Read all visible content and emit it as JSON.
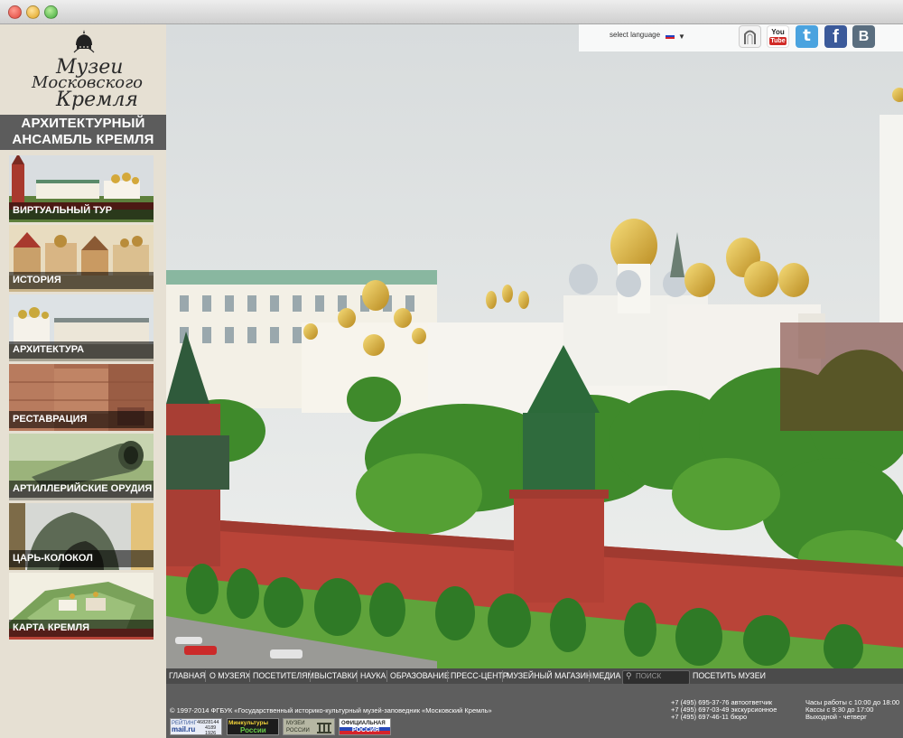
{
  "language": {
    "label": "select language"
  },
  "logo": {
    "line1": "Музеи",
    "line2": "Московского",
    "line3": "Кремля"
  },
  "sidebar": {
    "title_line1": "АРХИТЕКТУРНЫЙ",
    "title_line2": "АНСАМБЛЬ КРЕМЛЯ",
    "items": [
      {
        "label": "ВИРТУАЛЬНЫЙ ТУР"
      },
      {
        "label": "ИСТОРИЯ"
      },
      {
        "label": "АРХИТЕКТУРА"
      },
      {
        "label": "РЕСТАВРАЦИЯ"
      },
      {
        "label": "АРТИЛЛЕРИЙСКИЕ ОРУДИЯ"
      },
      {
        "label": "ЦАРЬ-КОЛОКОЛ"
      },
      {
        "label": "КАРТА КРЕМЛЯ"
      }
    ]
  },
  "social": {
    "youtube_top": "You",
    "youtube_bottom": "Tube",
    "twitter": "t",
    "facebook": "f",
    "vk": "B"
  },
  "menu": {
    "items": [
      "ГЛАВНАЯ",
      "О МУЗЕЯХ",
      "ПОСЕТИТЕЛЯМ",
      "ВЫСТАВКИ",
      "НАУКА",
      "ОБРАЗОВАНИЕ",
      "ПРЕСС-ЦЕНТР",
      "МУЗЕЙНЫЙ МАГАЗИН",
      "МЕДИА"
    ],
    "search_placeholder": "ПОИСК",
    "visit": "ПОСЕТИТЬ МУЗЕИ"
  },
  "footer": {
    "copyright": "© 1997-2014 ФГБУК «Государственный историко-культурный музей-заповедник «Московский Кремль»",
    "phones": [
      "+7 (495) 695-37-76 автоответчик",
      "+7 (495) 697-03-49 экскурсионное",
      "+7 (495) 697-46-11 бюро"
    ],
    "hours": [
      "Часы работы с 10:00 до 18:00",
      "Кассы с 9:30 до 17:00",
      "Выходной - четверг"
    ],
    "badges": {
      "rating_title": "РЕЙТИНГ",
      "rating_site": "mail.ru",
      "rating_n1": "46828144",
      "rating_n2": "4189",
      "rating_n3": "1926",
      "minkult_top": "Минкультуры",
      "minkult_bottom": "России",
      "museums_top": "МУЗЕИ",
      "museums_bottom": "РОССИИ",
      "official_top": "ОФИЦИАЛЬНАЯ",
      "official_bottom": "РОССИЯ"
    }
  },
  "colors": {
    "sidebar_bg": "#e6e0d3",
    "title_bg": "#5c5c5c",
    "menu_bg": "#4b4b4b",
    "footer_bg": "#5e5e5e",
    "kremlin_wall": "#b94438",
    "tower_roof": "#2f6b3d"
  }
}
